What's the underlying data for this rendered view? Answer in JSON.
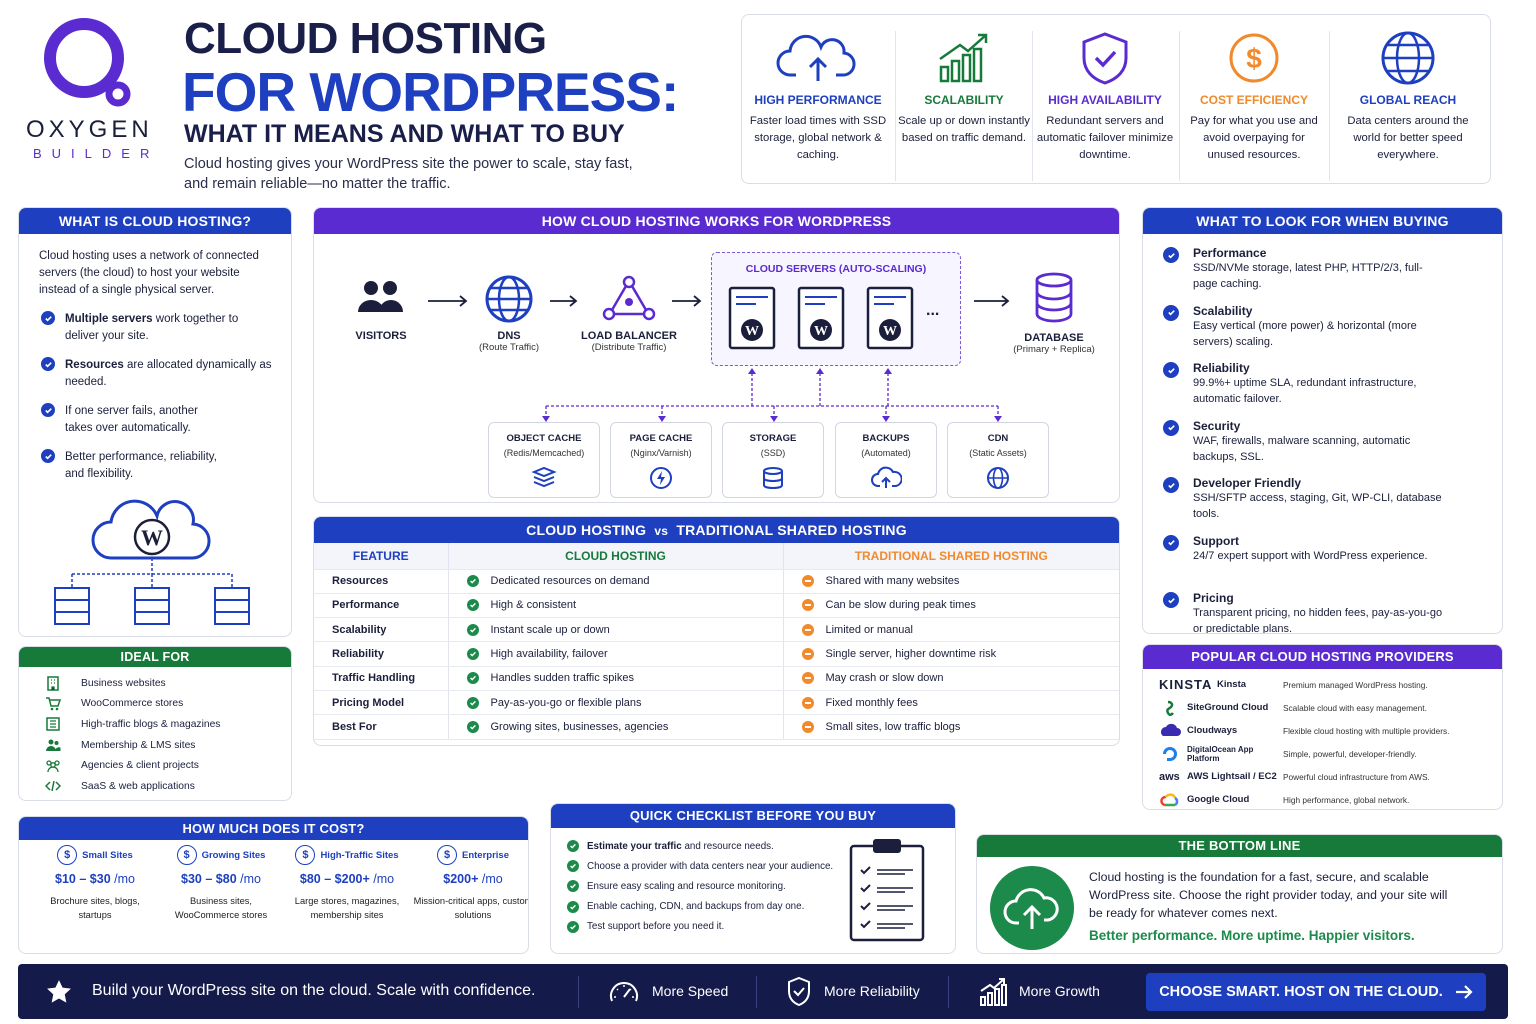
{
  "brand": {
    "name": "OXYGEN",
    "sub": "BUILDER"
  },
  "title": {
    "line1": "CLOUD HOSTING",
    "line2": "FOR WORDPRESS:",
    "line3": "WHAT IT MEANS AND WHAT TO BUY",
    "desc": "Cloud hosting gives your WordPress site the power to scale, stay fast, and remain reliable—no matter the traffic."
  },
  "benefits": [
    {
      "title": "HIGH PERFORMANCE",
      "desc": "Faster load times with SSD storage, global network & caching.",
      "color": "#1d3fc0",
      "icon": "cloud-upload-icon"
    },
    {
      "title": "SCALABILITY",
      "desc": "Scale up or down instantly based on traffic demand.",
      "color": "#177a3a",
      "icon": "growth-chart-icon"
    },
    {
      "title": "HIGH AVAILABILITY",
      "desc": "Redundant servers and automatic failover minimize downtime.",
      "color": "#5a2bd0",
      "icon": "shield-check-icon"
    },
    {
      "title": "COST EFFICIENCY",
      "desc": "Pay for what you use and avoid overpaying for unused resources.",
      "color": "#f08a2c",
      "icon": "dollar-icon"
    },
    {
      "title": "GLOBAL REACH",
      "desc": "Data centers around the world for better speed everywhere.",
      "color": "#1d3fc0",
      "icon": "globe-icon"
    }
  ],
  "what": {
    "header": "WHAT IS CLOUD HOSTING?",
    "intro": "Cloud hosting uses a network of connected servers (the cloud) to host your website instead of a single physical server.",
    "points": [
      {
        "bold": "Multiple servers",
        "rest": " work together to deliver your site."
      },
      {
        "bold": "Resources",
        "rest": " are allocated dynamically as needed."
      },
      {
        "bold": "",
        "rest": "If one server fails, another takes over automatically."
      },
      {
        "bold": "",
        "rest": "Better performance, reliability, and flexibility."
      }
    ]
  },
  "ideal": {
    "header": "IDEAL FOR",
    "items": [
      {
        "label": "Business websites",
        "icon": "building-icon"
      },
      {
        "label": "WooCommerce stores",
        "icon": "cart-icon"
      },
      {
        "label": "High-traffic blogs & magazines",
        "icon": "newspaper-icon"
      },
      {
        "label": "Membership & LMS sites",
        "icon": "users-icon"
      },
      {
        "label": "Agencies & client projects",
        "icon": "team-icon"
      },
      {
        "label": "SaaS & web applications",
        "icon": "code-icon"
      }
    ]
  },
  "how": {
    "header": "HOW CLOUD HOSTING WORKS FOR WORDPRESS",
    "visitors": "VISITORS",
    "dns": "DNS",
    "dns_sub": "(Route Traffic)",
    "lb": "LOAD BALANCER",
    "lb_sub": "(Distribute Traffic)",
    "cluster": "CLOUD SERVERS (AUTO-SCALING)",
    "ellipsis": "...",
    "db": "DATABASE",
    "db_sub": "(Primary + Replica)",
    "components": [
      {
        "title": "OBJECT CACHE",
        "sub": "(Redis/Memcached)"
      },
      {
        "title": "PAGE CACHE",
        "sub": "(Nginx/Varnish)"
      },
      {
        "title": "STORAGE",
        "sub": "(SSD)"
      },
      {
        "title": "BACKUPS",
        "sub": "(Automated)"
      },
      {
        "title": "CDN",
        "sub": "(Static Assets)"
      }
    ]
  },
  "compare": {
    "header_a": "CLOUD HOSTING",
    "header_vs": "vs",
    "header_b": "TRADITIONAL SHARED HOSTING",
    "col_feature": "FEATURE",
    "col_cloud": "CLOUD HOSTING",
    "col_shared": "TRADITIONAL SHARED HOSTING",
    "rows": [
      [
        "Resources",
        "Dedicated resources on demand",
        "Shared with many websites"
      ],
      [
        "Performance",
        "High & consistent",
        "Can be slow during peak times"
      ],
      [
        "Scalability",
        "Instant scale up or down",
        "Limited or manual"
      ],
      [
        "Reliability",
        "High availability, failover",
        "Single server, higher downtime risk"
      ],
      [
        "Traffic Handling",
        "Handles sudden traffic spikes",
        "May crash or slow down"
      ],
      [
        "Pricing Model",
        "Pay-as-you-go or flexible plans",
        "Fixed monthly fees"
      ],
      [
        "Best For",
        "Growing sites, businesses, agencies",
        "Small sites, low traffic blogs"
      ]
    ]
  },
  "buying": {
    "header": "WHAT TO LOOK FOR WHEN BUYING",
    "items": [
      {
        "title": "Performance",
        "desc": "SSD/NVMe storage, latest PHP, HTTP/2/3, full-page caching."
      },
      {
        "title": "Scalability",
        "desc": "Easy vertical (more power) & horizontal (more servers) scaling."
      },
      {
        "title": "Reliability",
        "desc": "99.9%+ uptime SLA, redundant infrastructure, automatic failover."
      },
      {
        "title": "Security",
        "desc": "WAF, firewalls, malware scanning, automatic backups, SSL."
      },
      {
        "title": "Developer Friendly",
        "desc": "SSH/SFTP access, staging, Git, WP-CLI, database tools."
      },
      {
        "title": "Support",
        "desc": "24/7 expert support with WordPress experience."
      },
      {
        "title": "Pricing",
        "desc": "Transparent pricing, no hidden fees, pay-as-you-go or predictable plans."
      }
    ]
  },
  "providers": {
    "header": "POPULAR CLOUD HOSTING PROVIDERS",
    "items": [
      {
        "logo": "KINSTA",
        "name": "Kinsta",
        "desc": "Premium managed WordPress hosting."
      },
      {
        "logo": "",
        "name": "SiteGround Cloud",
        "desc": "Scalable cloud with easy management."
      },
      {
        "logo": "",
        "name": "Cloudways",
        "desc": "Flexible cloud hosting with multiple providers."
      },
      {
        "logo": "",
        "name": "DigitalOcean App Platform",
        "desc": "Simple, powerful, developer-friendly."
      },
      {
        "logo": "aws",
        "name": "AWS Lightsail / EC2",
        "desc": "Powerful cloud infrastructure from AWS."
      },
      {
        "logo": "",
        "name": "Google Cloud",
        "desc": "High performance, global network."
      }
    ]
  },
  "cost": {
    "header": "HOW MUCH DOES IT COST?",
    "tiers": [
      {
        "name": "Small Sites",
        "price": "$10 – $30",
        "unit": " /mo",
        "desc": "Brochure sites, blogs, startups"
      },
      {
        "name": "Growing Sites",
        "price": "$30 – $80",
        "unit": " /mo",
        "desc": "Business sites, WooCommerce stores"
      },
      {
        "name": "High-Traffic Sites",
        "price": "$80 – $200+",
        "unit": " /mo",
        "desc": "Large stores, magazines, membership sites"
      },
      {
        "name": "Enterprise",
        "price": "$200+",
        "unit": " /mo",
        "desc": "Mission-critical apps, custom solutions"
      }
    ],
    "symbol": "$"
  },
  "checklist": {
    "header": "QUICK CHECKLIST BEFORE YOU BUY",
    "items": [
      {
        "bold": "Estimate your traffic",
        "rest": " and resource needs."
      },
      {
        "bold": "",
        "rest": "Choose a provider with data centers near your audience."
      },
      {
        "bold": "",
        "rest": "Ensure easy scaling and resource monitoring."
      },
      {
        "bold": "",
        "rest": "Enable caching, CDN, and backups from day one."
      },
      {
        "bold": "",
        "rest": "Test support before you need it."
      }
    ]
  },
  "bottom": {
    "header": "THE BOTTOM LINE",
    "text": "Cloud hosting is the foundation for a fast, secure, and scalable WordPress site. Choose the right provider today, and your site will be ready for whatever comes next.",
    "tagline": "Better performance. More uptime. Happier visitors."
  },
  "footer": {
    "text": "Build your WordPress site on the cloud. Scale with confidence.",
    "speed": "More Speed",
    "reliability": "More Reliability",
    "growth": "More Growth",
    "cta": "CHOOSE SMART. HOST ON THE CLOUD."
  },
  "colors": {
    "blue": "#1d3fc0",
    "purple": "#5a2bd0",
    "green": "#177a3a",
    "orange": "#f08a2c",
    "navy": "#141a4a"
  }
}
